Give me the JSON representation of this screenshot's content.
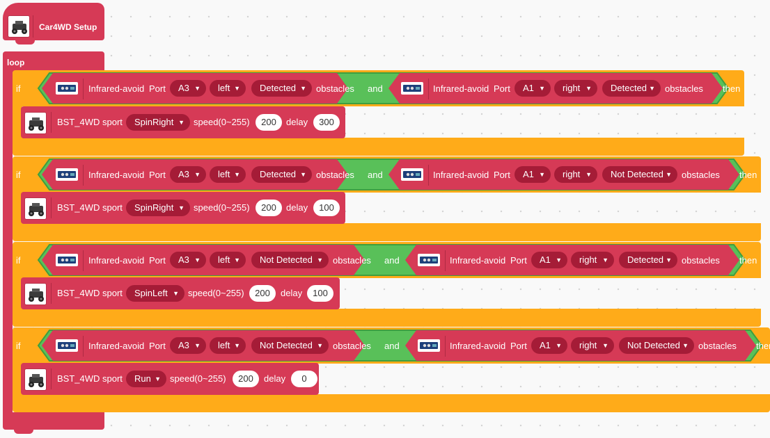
{
  "colors": {
    "setup": "#d63a56",
    "control": "#ffab19",
    "logic": "#59c059",
    "dropdown": "#a51c37"
  },
  "setup_block": {
    "label": "Car4WD Setup",
    "icon": "car-icon"
  },
  "loop_block": {
    "label": "loop"
  },
  "conditions": [
    {
      "if_label": "if",
      "then_label": "then",
      "and_label": "and",
      "left": {
        "prefix": "Infrared-avoid",
        "port_label": "Port",
        "port": "A3",
        "side": "left",
        "state": "Detected",
        "suffix": "obstacles"
      },
      "right": {
        "prefix": "Infrared-avoid",
        "port_label": "Port",
        "port": "A1",
        "side": "right",
        "state": "Detected",
        "suffix": "obstacles"
      },
      "action": {
        "prefix": "BST_4WD sport",
        "mode": "SpinRight",
        "speed_label": "speed(0~255)",
        "speed": "200",
        "delay_label": "delay",
        "delay": "300"
      }
    },
    {
      "if_label": "if",
      "then_label": "then",
      "and_label": "and",
      "left": {
        "prefix": "Infrared-avoid",
        "port_label": "Port",
        "port": "A3",
        "side": "left",
        "state": "Detected",
        "suffix": "obstacles"
      },
      "right": {
        "prefix": "Infrared-avoid",
        "port_label": "Port",
        "port": "A1",
        "side": "right",
        "state": "Not Detected",
        "suffix": "obstacles"
      },
      "action": {
        "prefix": "BST_4WD sport",
        "mode": "SpinRight",
        "speed_label": "speed(0~255)",
        "speed": "200",
        "delay_label": "delay",
        "delay": "100"
      }
    },
    {
      "if_label": "if",
      "then_label": "then",
      "and_label": "and",
      "left": {
        "prefix": "Infrared-avoid",
        "port_label": "Port",
        "port": "A3",
        "side": "left",
        "state": "Not Detected",
        "suffix": "obstacles"
      },
      "right": {
        "prefix": "Infrared-avoid",
        "port_label": "Port",
        "port": "A1",
        "side": "right",
        "state": "Detected",
        "suffix": "obstacles"
      },
      "action": {
        "prefix": "BST_4WD sport",
        "mode": "SpinLeft",
        "speed_label": "speed(0~255)",
        "speed": "200",
        "delay_label": "delay",
        "delay": "100"
      }
    },
    {
      "if_label": "if",
      "then_label": "then",
      "and_label": "and",
      "left": {
        "prefix": "Infrared-avoid",
        "port_label": "Port",
        "port": "A3",
        "side": "left",
        "state": "Not Detected",
        "suffix": "obstacles"
      },
      "right": {
        "prefix": "Infrared-avoid",
        "port_label": "Port",
        "port": "A1",
        "side": "right",
        "state": "Not Detected",
        "suffix": "obstacles"
      },
      "action": {
        "prefix": "BST_4WD sport",
        "mode": "Run",
        "speed_label": "speed(0~255)",
        "speed": "200",
        "delay_label": "delay",
        "delay": "0"
      }
    }
  ],
  "dropdown_icon": "triangle-down-icon"
}
